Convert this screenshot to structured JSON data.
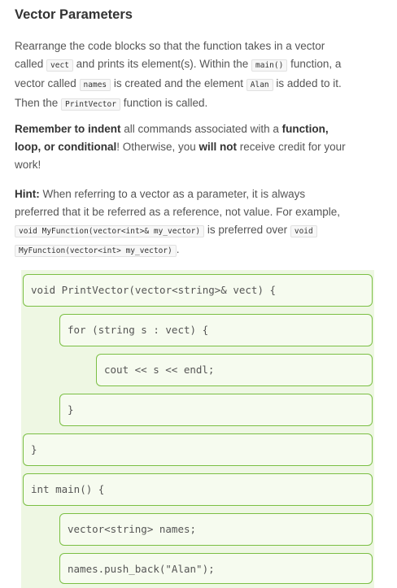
{
  "title": "Vector Parameters",
  "paragraph1": {
    "t1": "Rearrange the code blocks so that the function takes in a vector",
    "t2": "called ",
    "code_vect": "vect",
    "t3": " and prints its element(s). Within the ",
    "code_main": "main()",
    "t4": " function, a",
    "t5": "vector called ",
    "code_names": "names",
    "t6": " is created and the element ",
    "code_alan": "Alan",
    "t7": " is added to it.",
    "t8": "Then the ",
    "code_print": "PrintVector",
    "t9": " function is called."
  },
  "paragraph2": {
    "bold1": "Remember to indent",
    "t1": " all commands associated with a ",
    "bold2": "function,",
    "bold3": "loop, or conditional",
    "t2": "! Otherwise, you ",
    "bold4": "will not",
    "t3": " receive credit for your",
    "t4": "work!"
  },
  "paragraph3": {
    "bold1": "Hint:",
    "t1": " When referring to a vector as a parameter, it is always",
    "t2": "preferred that it be referred as a reference, not value. For example,",
    "code1": "void MyFunction(vector<int>& my_vector)",
    "t3": " is preferred over ",
    "code2a": "void",
    "code2b": "MyFunction(vector<int> my_vector)",
    "t4": "."
  },
  "code_blocks": [
    "void PrintVector(vector<string>& vect) {",
    "for (string s : vect) {",
    "cout << s << endl;",
    "}",
    "}",
    "int main() {",
    "vector<string> names;",
    "names.push_back(\"Alan\");"
  ],
  "colors": {
    "block_border": "#7bbf44",
    "block_bg": "#f6fbef",
    "workspace_bg": "#eef7e3"
  }
}
